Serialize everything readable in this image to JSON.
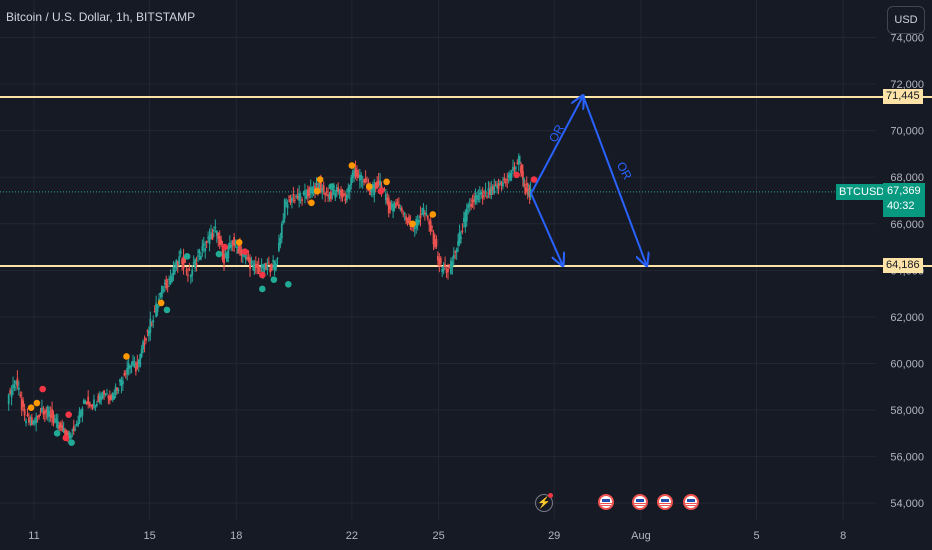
{
  "header": {
    "title": "Bitcoin / U.S. Dollar, 1h, BITSTAMP",
    "currency_button": "USD"
  },
  "colors": {
    "background": "#161a25",
    "grid": "#232633",
    "level_line": "#fde3a7",
    "up": "#26a69a",
    "down": "#ef5350",
    "arrow": "#2962ff",
    "marker_orange": "#ff9800",
    "marker_red": "#f23645",
    "marker_teal": "#22ab94"
  },
  "chart_data": {
    "type": "candlestick",
    "symbol": "BTCUSD",
    "yticks": [
      54000,
      56000,
      58000,
      60000,
      62000,
      64000,
      66000,
      68000,
      70000,
      72000,
      74000
    ],
    "ytick_labels": [
      "54,000",
      "56,000",
      "58,000",
      "60,000",
      "62,000",
      "64,000",
      "66,000",
      "68,000",
      "70,000",
      "72,000",
      "74,000"
    ],
    "xticks": [
      "11",
      "15",
      "18",
      "22",
      "25",
      "29",
      "Aug",
      "5",
      "8"
    ],
    "xtick_days": [
      11,
      15,
      18,
      22,
      25,
      29,
      32,
      36,
      39
    ],
    "levels": [
      {
        "value": 71445,
        "label": "71,445"
      },
      {
        "value": 64186,
        "label": "64,186"
      }
    ],
    "current_price": {
      "value": 67369,
      "label": "67,369",
      "countdown": "40:32"
    },
    "price_path": [
      [
        10.1,
        58500
      ],
      [
        10.4,
        59300
      ],
      [
        10.7,
        57600
      ],
      [
        11.0,
        57400
      ],
      [
        11.3,
        58100
      ],
      [
        11.6,
        57800
      ],
      [
        11.9,
        57200
      ],
      [
        12.2,
        56800
      ],
      [
        12.5,
        57500
      ],
      [
        12.8,
        58400
      ],
      [
        13.1,
        58300
      ],
      [
        13.4,
        58800
      ],
      [
        13.7,
        58600
      ],
      [
        14.0,
        59200
      ],
      [
        14.3,
        60000
      ],
      [
        14.6,
        59800
      ],
      [
        14.9,
        61200
      ],
      [
        15.2,
        62200
      ],
      [
        15.5,
        63300
      ],
      [
        15.8,
        63800
      ],
      [
        16.1,
        64600
      ],
      [
        16.4,
        63800
      ],
      [
        16.7,
        64600
      ],
      [
        17.0,
        65200
      ],
      [
        17.3,
        65700
      ],
      [
        17.6,
        64500
      ],
      [
        17.9,
        65200
      ],
      [
        18.2,
        64800
      ],
      [
        18.5,
        64300
      ],
      [
        18.8,
        64000
      ],
      [
        19.1,
        64100
      ],
      [
        19.4,
        64300
      ],
      [
        19.7,
        66800
      ],
      [
        20.0,
        67200
      ],
      [
        20.3,
        67100
      ],
      [
        20.6,
        67400
      ],
      [
        20.9,
        67600
      ],
      [
        21.2,
        67200
      ],
      [
        21.5,
        67400
      ],
      [
        21.8,
        67100
      ],
      [
        22.1,
        68300
      ],
      [
        22.4,
        67800
      ],
      [
        22.7,
        67400
      ],
      [
        23.0,
        67800
      ],
      [
        23.3,
        66700
      ],
      [
        23.6,
        66900
      ],
      [
        23.9,
        66200
      ],
      [
        24.2,
        65900
      ],
      [
        24.5,
        66600
      ],
      [
        24.8,
        65600
      ],
      [
        25.1,
        64100
      ],
      [
        25.4,
        64000
      ],
      [
        25.7,
        65200
      ],
      [
        26.0,
        66500
      ],
      [
        26.3,
        67100
      ],
      [
        26.6,
        67200
      ],
      [
        26.9,
        67400
      ],
      [
        27.2,
        67700
      ],
      [
        27.5,
        68100
      ],
      [
        27.8,
        68700
      ],
      [
        28.0,
        67600
      ],
      [
        28.2,
        67300
      ]
    ],
    "markers": [
      {
        "day": 10.9,
        "price": 58100,
        "color": "marker_orange"
      },
      {
        "day": 11.1,
        "price": 58300,
        "color": "marker_orange"
      },
      {
        "day": 11.3,
        "price": 58900,
        "color": "marker_red"
      },
      {
        "day": 11.8,
        "price": 57000,
        "color": "marker_teal"
      },
      {
        "day": 12.1,
        "price": 56800,
        "color": "marker_red"
      },
      {
        "day": 12.3,
        "price": 56600,
        "color": "marker_teal"
      },
      {
        "day": 12.2,
        "price": 57800,
        "color": "marker_red"
      },
      {
        "day": 14.2,
        "price": 60300,
        "color": "marker_orange"
      },
      {
        "day": 15.4,
        "price": 62600,
        "color": "marker_orange"
      },
      {
        "day": 15.6,
        "price": 62300,
        "color": "marker_teal"
      },
      {
        "day": 16.3,
        "price": 64600,
        "color": "marker_teal"
      },
      {
        "day": 17.4,
        "price": 64700,
        "color": "marker_teal"
      },
      {
        "day": 17.6,
        "price": 65000,
        "color": "marker_red"
      },
      {
        "day": 18.1,
        "price": 65200,
        "color": "marker_orange"
      },
      {
        "day": 18.3,
        "price": 64800,
        "color": "marker_red"
      },
      {
        "day": 18.9,
        "price": 63800,
        "color": "marker_red"
      },
      {
        "day": 18.9,
        "price": 63200,
        "color": "marker_teal"
      },
      {
        "day": 19.3,
        "price": 63600,
        "color": "marker_teal"
      },
      {
        "day": 19.8,
        "price": 63400,
        "color": "marker_teal"
      },
      {
        "day": 20.6,
        "price": 66900,
        "color": "marker_orange"
      },
      {
        "day": 20.8,
        "price": 67400,
        "color": "marker_orange"
      },
      {
        "day": 20.9,
        "price": 67900,
        "color": "marker_orange"
      },
      {
        "day": 21.3,
        "price": 67600,
        "color": "marker_teal"
      },
      {
        "day": 22.0,
        "price": 68500,
        "color": "marker_orange"
      },
      {
        "day": 22.6,
        "price": 67600,
        "color": "marker_orange"
      },
      {
        "day": 23.0,
        "price": 67400,
        "color": "marker_red"
      },
      {
        "day": 23.2,
        "price": 67800,
        "color": "marker_orange"
      },
      {
        "day": 24.1,
        "price": 66000,
        "color": "marker_orange"
      },
      {
        "day": 24.8,
        "price": 66400,
        "color": "marker_orange"
      },
      {
        "day": 27.7,
        "price": 68100,
        "color": "marker_red"
      },
      {
        "day": 28.3,
        "price": 67900,
        "color": "marker_red"
      }
    ],
    "annotations": [
      {
        "text": "OR",
        "day": 29.2,
        "price": 69800,
        "rotate": -62
      },
      {
        "text": "OR",
        "day": 31.3,
        "price": 68200,
        "rotate": 62
      }
    ],
    "arrows": [
      {
        "from": [
          28.2,
          67300
        ],
        "to": [
          29.3,
          64200
        ]
      },
      {
        "from": [
          28.2,
          67300
        ],
        "to": [
          30.0,
          71500
        ]
      },
      {
        "from": [
          30.0,
          71500
        ],
        "to": [
          32.2,
          64200
        ]
      }
    ],
    "events_count": 4
  }
}
